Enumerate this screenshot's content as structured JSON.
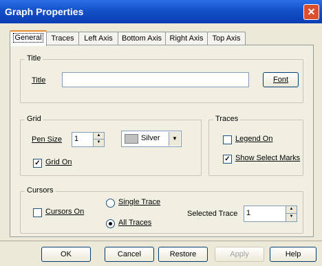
{
  "window": {
    "title": "Graph Properties",
    "close_glyph": "✕"
  },
  "tabs": [
    "General",
    "Traces",
    "Left Axis",
    "Bottom Axis",
    "Right Axis",
    "Top Axis"
  ],
  "title_group": {
    "label": "Title",
    "title_label": "Title",
    "title_value": "",
    "font_button": "Font"
  },
  "grid_group": {
    "label": "Grid",
    "pen_size_label": "Pen Size",
    "pen_size_value": "1",
    "color_value": "Silver",
    "color_swatch": "#c0c0c0",
    "grid_on_label": "Grid On",
    "grid_on_checked": true
  },
  "traces_group": {
    "label": "Traces",
    "legend_on_label": "Legend On",
    "legend_on_checked": false,
    "show_select_marks_label": "Show Select Marks",
    "show_select_marks_checked": true
  },
  "cursors_group": {
    "label": "Cursors",
    "cursors_on_label": "Cursors On",
    "cursors_on_checked": false,
    "single_trace_label": "Single Trace",
    "all_traces_label": "All Traces",
    "selected_mode": "all",
    "selected_trace_label": "Selected Trace",
    "selected_trace_value": "1"
  },
  "buttons": {
    "ok": "OK",
    "cancel": "Cancel",
    "restore": "Restore",
    "apply": "Apply",
    "help": "Help"
  },
  "colors": {
    "titlebar": "#1450c8",
    "dialog_bg": "#ece9d8",
    "panel_bg": "#f1efe2",
    "active_tab_accent": "#e68b2c"
  }
}
